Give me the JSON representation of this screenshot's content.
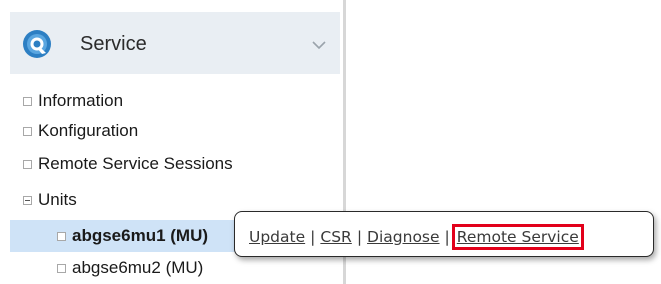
{
  "sidebar": {
    "header": {
      "title": "Service",
      "logo_icon": "service-logo-icon",
      "expand_icon": "chevron-down-icon",
      "background": "#e9eef3"
    },
    "items": [
      {
        "label": "Information",
        "icon": "square-icon"
      },
      {
        "label": "Konfiguration",
        "icon": "square-icon"
      },
      {
        "label": "Remote Service Sessions",
        "icon": "square-icon"
      },
      {
        "label": "Units",
        "icon": "collapse-minus-icon"
      },
      {
        "label": "abgse6mu1 (MU)",
        "icon": "square-icon",
        "selected": true
      },
      {
        "label": "abgse6mu2 (MU)",
        "icon": "square-icon"
      }
    ]
  },
  "popup": {
    "links": {
      "update": "Update",
      "csr": "CSR",
      "diagnose": "Diagnose",
      "remote_service": "Remote Service"
    },
    "separator": "|",
    "highlight_color": "#e2001a"
  }
}
